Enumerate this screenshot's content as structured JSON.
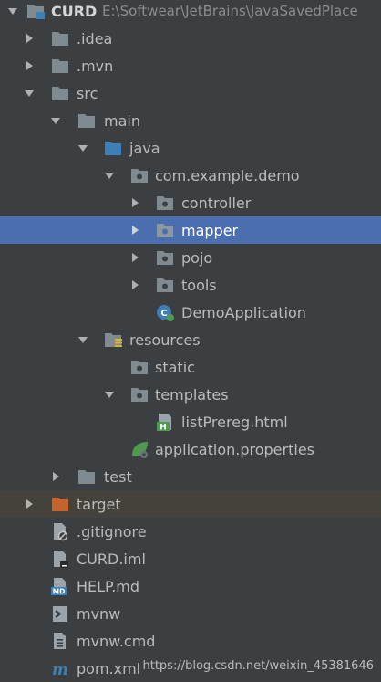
{
  "project": {
    "name": "CURD",
    "path": "E:\\Softwear\\JetBrains\\JavaSavedPlace"
  },
  "tree": [
    {
      "label": "CURD",
      "arrow": "down",
      "icon": "module-folder-icon"
    },
    {
      "label": ".idea",
      "arrow": "right",
      "icon": "folder-icon"
    },
    {
      "label": ".mvn",
      "arrow": "right",
      "icon": "folder-icon"
    },
    {
      "label": "src",
      "arrow": "down",
      "icon": "folder-icon"
    },
    {
      "label": "main",
      "arrow": "down",
      "icon": "folder-icon"
    },
    {
      "label": "java",
      "arrow": "down",
      "icon": "source-folder-icon"
    },
    {
      "label": "com.example.demo",
      "arrow": "down",
      "icon": "package-icon"
    },
    {
      "label": "controller",
      "arrow": "right",
      "icon": "package-icon"
    },
    {
      "label": "mapper",
      "arrow": "right",
      "icon": "package-icon"
    },
    {
      "label": "pojo",
      "arrow": "right",
      "icon": "package-icon"
    },
    {
      "label": "tools",
      "arrow": "right",
      "icon": "package-icon"
    },
    {
      "label": "DemoApplication",
      "arrow": "none",
      "icon": "spring-class-icon"
    },
    {
      "label": "resources",
      "arrow": "down",
      "icon": "resources-folder-icon"
    },
    {
      "label": "static",
      "arrow": "none",
      "icon": "package-icon"
    },
    {
      "label": "templates",
      "arrow": "down",
      "icon": "package-icon"
    },
    {
      "label": "listPrereg.html",
      "arrow": "none",
      "icon": "html-file-icon"
    },
    {
      "label": "application.properties",
      "arrow": "none",
      "icon": "spring-properties-icon"
    },
    {
      "label": "test",
      "arrow": "right",
      "icon": "folder-icon"
    },
    {
      "label": "target",
      "arrow": "right",
      "icon": "excluded-folder-icon"
    },
    {
      "label": ".gitignore",
      "arrow": "none",
      "icon": "gitignore-file-icon"
    },
    {
      "label": "CURD.iml",
      "arrow": "none",
      "icon": "iml-file-icon"
    },
    {
      "label": "HELP.md",
      "arrow": "none",
      "icon": "markdown-file-icon"
    },
    {
      "label": "mvnw",
      "arrow": "none",
      "icon": "script-file-icon"
    },
    {
      "label": "mvnw.cmd",
      "arrow": "none",
      "icon": "text-file-icon"
    },
    {
      "label": "pom.xml",
      "arrow": "none",
      "icon": "maven-file-icon"
    }
  ],
  "selected": "mapper",
  "highlighted": "target",
  "watermark": "https://blog.csdn.net/weixin_45381646",
  "colors": {
    "background": "#3c3f41",
    "selection": "#4b6eaf",
    "highlight": "#45413b",
    "folder": "#7f8b91",
    "source_folder": "#3d7fb6",
    "excluded_folder": "#c7622d",
    "spring": "#4f9a4f"
  }
}
